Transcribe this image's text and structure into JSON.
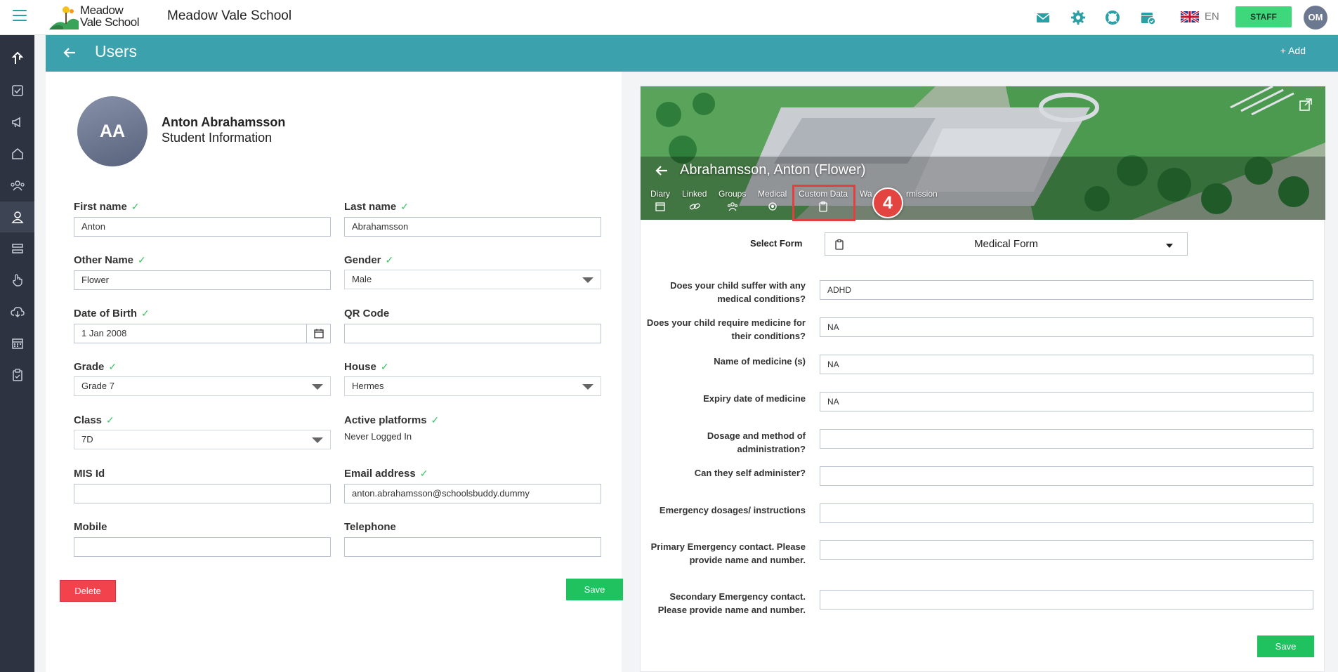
{
  "topbar": {
    "logo_text_line1": "Meadow",
    "logo_text_line2": "Vale School",
    "school_name": "Meadow Vale School",
    "language": "EN",
    "staff_label": "STAFF",
    "user_initials": "OM",
    "icons": [
      "mail-icon",
      "gear-icon",
      "lifebuoy-icon",
      "calendar-check-icon",
      "uk-flag-icon"
    ],
    "accent_color": "#2aa0a6"
  },
  "sidebar": {
    "items": [
      "share-icon",
      "checkbox-icon",
      "megaphone-icon",
      "home-icon",
      "group-icon",
      "user-icon",
      "list-icon",
      "hand-icon",
      "cloud-download-icon",
      "calendar-icon",
      "clipboard-icon"
    ],
    "active_index": 5
  },
  "header": {
    "title": "Users",
    "add_label": "+ Add",
    "band_color": "#3ba1ac"
  },
  "profile": {
    "initials": "AA",
    "name": "Anton Abrahamsson",
    "subtitle": "Student Information"
  },
  "fields": {
    "first_name": {
      "label": "First name",
      "value": "Anton"
    },
    "last_name": {
      "label": "Last name",
      "value": "Abrahamsson"
    },
    "other_name": {
      "label": "Other Name",
      "value": "Flower"
    },
    "gender": {
      "label": "Gender",
      "value": "Male"
    },
    "dob": {
      "label": "Date of Birth",
      "value": "1 Jan 2008"
    },
    "qr_code": {
      "label": "QR Code",
      "value": ""
    },
    "grade": {
      "label": "Grade",
      "value": "Grade 7"
    },
    "house": {
      "label": "House",
      "value": "Hermes"
    },
    "class": {
      "label": "Class",
      "value": "7D"
    },
    "active_platforms": {
      "label": "Active platforms",
      "value": "Never Logged In"
    },
    "mis_id": {
      "label": "MIS Id",
      "value": ""
    },
    "email": {
      "label": "Email address",
      "value": "anton.abrahamsson@schoolsbuddy.dummy"
    },
    "mobile": {
      "label": "Mobile",
      "value": ""
    },
    "telephone": {
      "label": "Telephone",
      "value": ""
    }
  },
  "actions": {
    "delete_label": "Delete",
    "save_label": "Save"
  },
  "detail": {
    "title": "Abrahamsson, Anton (Flower)",
    "tabs": [
      {
        "label": "Diary",
        "icon": "calendar-icon"
      },
      {
        "label": "Linked",
        "icon": "link-icon"
      },
      {
        "label": "Groups",
        "icon": "group-icon"
      },
      {
        "label": "Medical",
        "icon": "medical-icon"
      },
      {
        "label": "Custom Data",
        "icon": "clipboard-icon"
      },
      {
        "label": "Wa",
        "icon": ""
      },
      {
        "label": "rmission",
        "icon": ""
      }
    ],
    "step_number": "4",
    "select_form_label": "Select Form",
    "select_form_value": "Medical Form",
    "questions": [
      {
        "label": "Does your child suffer with any medical conditions?",
        "value": "ADHD"
      },
      {
        "label": "Does your child require medicine for their conditions?",
        "value": "NA"
      },
      {
        "label": "Name of medicine (s)",
        "value": "NA"
      },
      {
        "label": "Expiry date of medicine",
        "value": "NA"
      },
      {
        "label": "Dosage and method of administration?",
        "value": ""
      },
      {
        "label": "Can they self administer?",
        "value": ""
      },
      {
        "label": "Emergency dosages/ instructions",
        "value": ""
      },
      {
        "label": "Primary Emergency contact. Please provide name and number.",
        "value": ""
      },
      {
        "label": "Secondary Emergency contact. Please provide name and number.",
        "value": ""
      }
    ],
    "save_label": "Save",
    "highlight_color": "#e33f3f"
  }
}
